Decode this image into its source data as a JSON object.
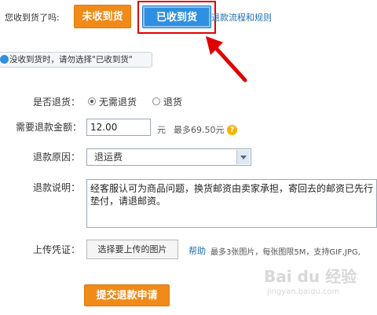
{
  "header": {
    "question": "您收到货了吗:",
    "not_received_label": "未收到货",
    "received_label": "已收到货",
    "rules_link": "退款流程和规则"
  },
  "notice": "没收到货时，请勿选择\"已收到货\"",
  "form": {
    "return_goods": {
      "label": "是否退货：",
      "option_no": "无需退货",
      "option_yes": "退货",
      "selected": "无需退货"
    },
    "amount": {
      "label": "需要退款金额：",
      "value": "12.00",
      "unit": "元",
      "max_hint": "最多69.50元"
    },
    "reason": {
      "label": "退款原因：",
      "selected": "退运费"
    },
    "description": {
      "label": "退款说明：",
      "value": "经客服认可为商品问题，换货邮资由卖家承担，寄回去的邮资已先行垫付，请退邮资。"
    },
    "voucher": {
      "label": "上传凭证：",
      "button": "选择要上传的图片",
      "help_link": "帮助",
      "hint": "最多3张图片，每张图限5M，支持GIF,JPG,"
    },
    "submit_label": "提交退款申请"
  },
  "watermark": {
    "brand": "Bai du 经验",
    "url": "jingyan.baidu.com"
  },
  "colors": {
    "orange": "#f08a19",
    "blue": "#2f8fe0",
    "highlight_red": "#e00000",
    "link": "#1f6fb3"
  }
}
